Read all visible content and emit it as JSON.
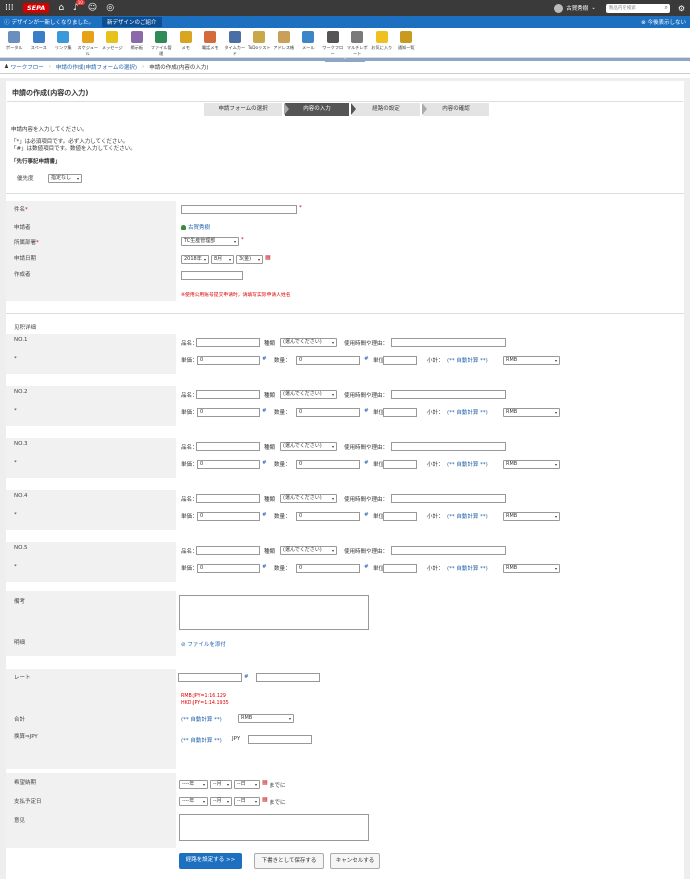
{
  "topbar": {
    "brand": "SEPA",
    "notifications": "10",
    "user_name": "古賀秀樹",
    "search_placeholder": "製品内を検索"
  },
  "notice": {
    "message": "デザインが一新しくなりました。",
    "new_design_label": "新デザインのご紹介",
    "hide_label": "今後表示しない"
  },
  "apps": [
    "ポータル",
    "スペース",
    "リンク集",
    "スケジュール",
    "メッセージ",
    "掲示板",
    "ファイル管理",
    "メモ",
    "電話メモ",
    "タイムカード",
    "ToDoリスト",
    "アドレス帳",
    "メール",
    "ワークフロー",
    "マルチレポート",
    "お気に入り",
    "通知一覧"
  ],
  "breadcrumb": {
    "root": "ワークフロー",
    "mid": "申請の作成(申請フォームの選択)",
    "current": "申請の作成(内容の入力)"
  },
  "page_title": "申請の作成(内容の入力)",
  "steps": [
    "申請フォームの選択",
    "内容の入力",
    "経路の設定",
    "内容の確認"
  ],
  "intro": "申請内容を入力してください。",
  "notes": [
    "「*」は必須項目です。必ず入力してください。",
    "「#」は数値項目です。数値を入力してください。"
  ],
  "form_name": "「先行事記申請書」",
  "priority": {
    "label": "優先度",
    "value": "指定なし"
  },
  "fields": {
    "subject": "件名",
    "applicant": "申請者",
    "applicant_name": "古賀秀樹",
    "department": "所属部署",
    "department_value": "TC生産管理部",
    "apply_date": "申請日期",
    "year": "2018年",
    "month": "8月",
    "day": "3(金)",
    "author": "作成者",
    "author_note": "※使用公用账号提交申请时，请填写实际申请人姓名"
  },
  "details_label": "见积详细",
  "line_items": [
    {
      "no": "NO.1"
    },
    {
      "no": "NO.2"
    },
    {
      "no": "NO.3"
    },
    {
      "no": "NO.4"
    },
    {
      "no": "NO.5"
    }
  ],
  "item_labels": {
    "star": "*",
    "product": "品名：",
    "kind": "種類",
    "kind_value": "(選んでください)",
    "reason": "使用時間や理由：",
    "unit_price": "単価：",
    "qty": "数量：",
    "unit": "単位",
    "subtotal": "小計：",
    "auto_calc": "(** 自動計算 **)",
    "currency": "RMB",
    "zero": "0",
    "hash": "#"
  },
  "remarks": "備考",
  "attachment": {
    "label": "明细",
    "link": "ファイルを添付"
  },
  "rate": {
    "label": "レート",
    "hash": "#",
    "rmb": "RMB:JPY=1:16.129",
    "hkd": "HKD:JPY=1:14.1935"
  },
  "total": {
    "label": "合計",
    "auto": "(** 自動計算 **)",
    "currency": "RMB"
  },
  "jpy": {
    "label": "换算⇒JPY",
    "auto": "(** 自動計算 **)",
    "unit": "JPY"
  },
  "desired_date": {
    "label": "希望納期",
    "year": "----年",
    "month": "--月",
    "day": "--日",
    "suffix": "までに"
  },
  "payment_date": {
    "label": "支払予定日",
    "year": "----年",
    "month": "--月",
    "day": "--日",
    "suffix": "までに"
  },
  "opinion": "意见",
  "buttons": {
    "route": "経路を設定する >>",
    "draft": "下書きとして保存する",
    "cancel": "キャンセルする"
  },
  "colors": {
    "accent": "#1d6fc0",
    "dark": "#3a3a3a",
    "required": "#dd0000"
  }
}
